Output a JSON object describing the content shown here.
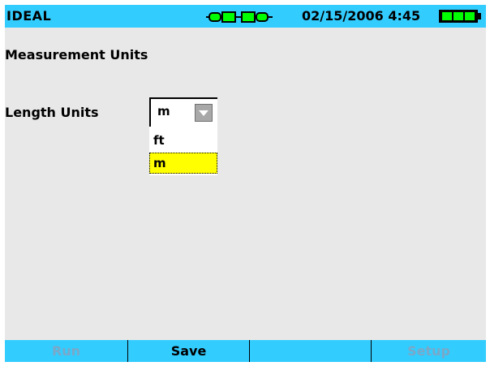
{
  "statusbar": {
    "brand": "IDEAL",
    "datetime": "02/15/2006 4:45",
    "link_icon": "link-status-icon",
    "battery_icon": "battery-full-icon",
    "battery_level": 1.0,
    "accent_color": "#33ccff"
  },
  "page": {
    "title": "Measurement Units"
  },
  "length_units": {
    "label": "Length Units",
    "selected": "m",
    "options": [
      "ft",
      "m"
    ],
    "highlighted_option": "m",
    "highlight_color": "#ffff00"
  },
  "softkeys": [
    {
      "label": "Run",
      "enabled": false
    },
    {
      "label": "Save",
      "enabled": true
    },
    {
      "label": "",
      "enabled": true
    },
    {
      "label": "Setup",
      "enabled": false
    }
  ]
}
